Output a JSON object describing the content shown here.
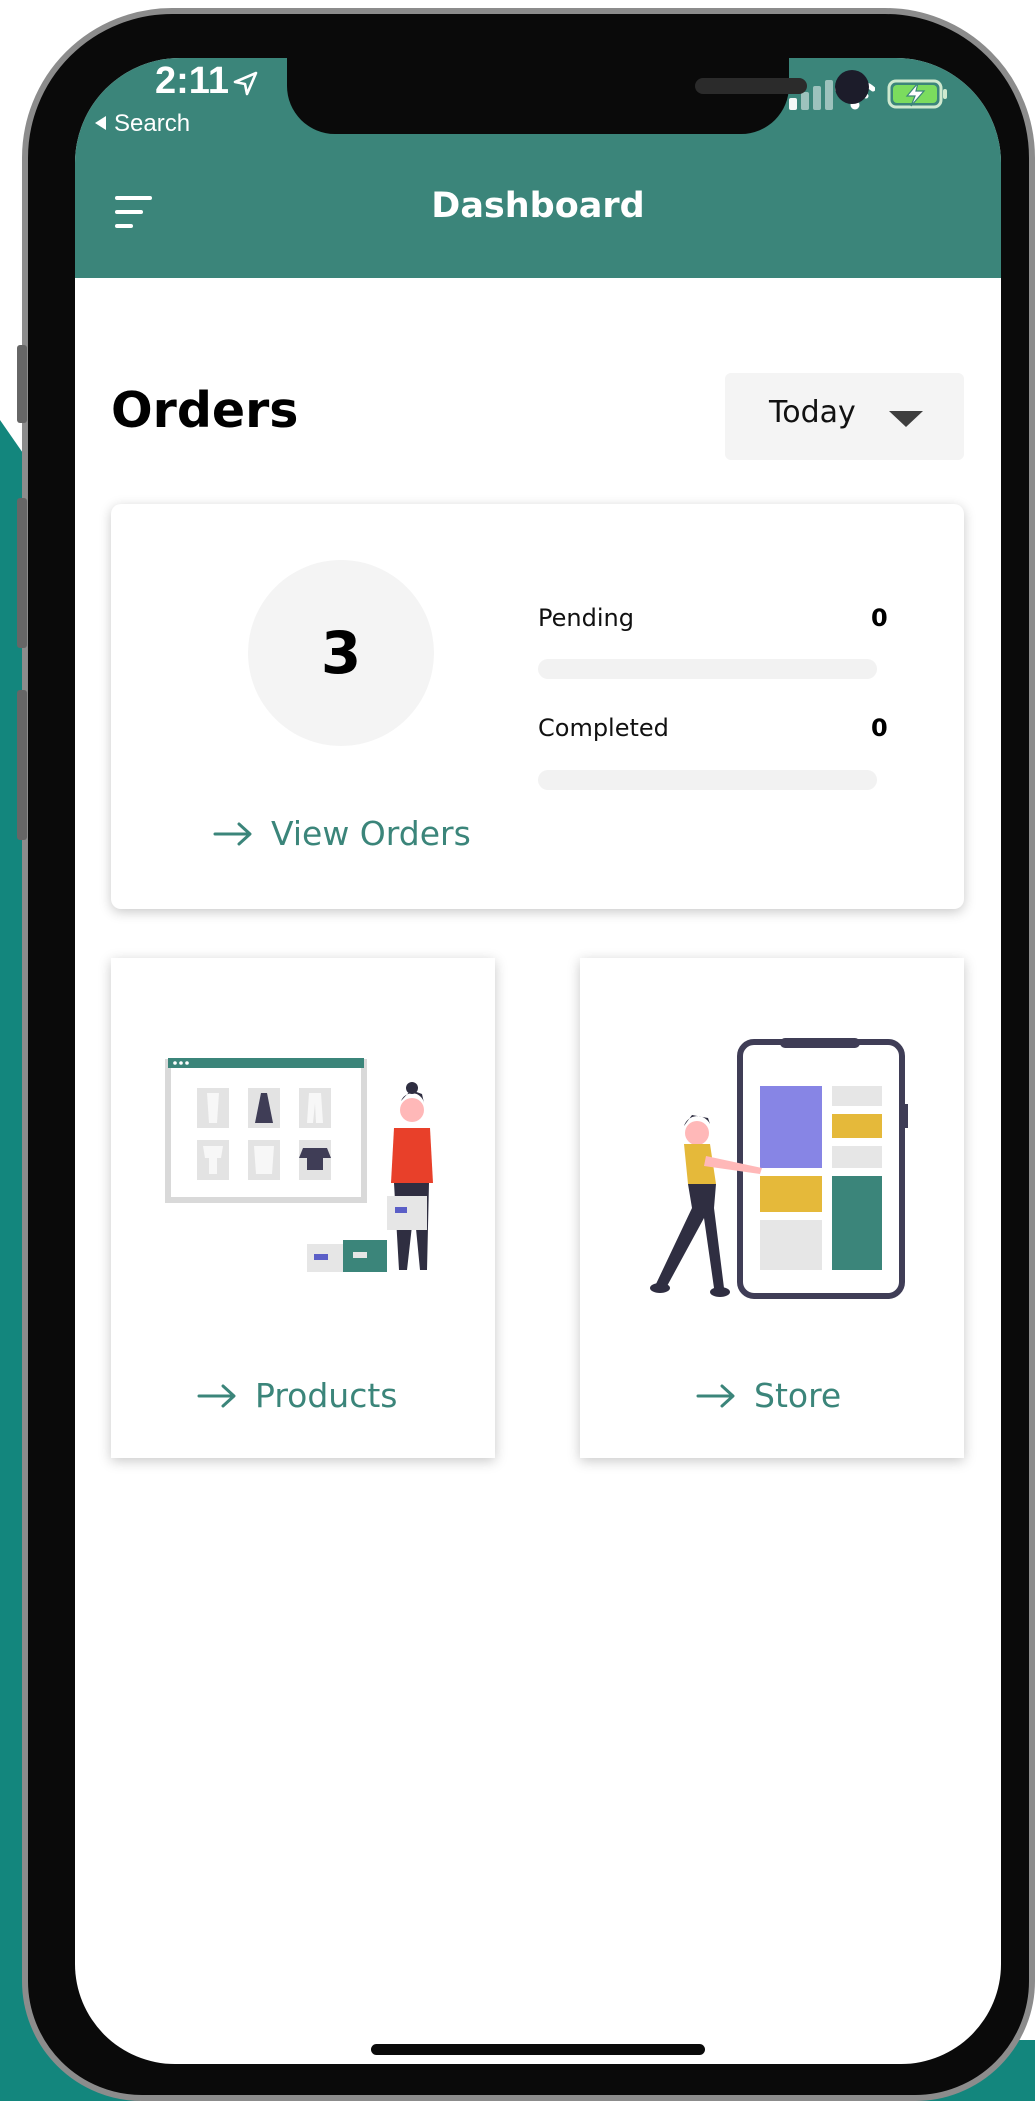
{
  "status_bar": {
    "time": "2:11",
    "back_label": "Search"
  },
  "header": {
    "title": "Dashboard",
    "color": "#3b857a"
  },
  "orders": {
    "heading": "Orders",
    "period": "Today",
    "total": "3",
    "stats": [
      {
        "label": "Pending",
        "value": "0",
        "fraction": 0
      },
      {
        "label": "Completed",
        "value": "0",
        "fraction": 0
      }
    ],
    "view_link": "View Orders"
  },
  "tiles": {
    "products_label": "Products",
    "store_label": "Store"
  },
  "icons": {
    "menu": "hamburger-menu-icon",
    "arrow": "arrow-right-icon",
    "dropdown": "caret-down-icon"
  }
}
